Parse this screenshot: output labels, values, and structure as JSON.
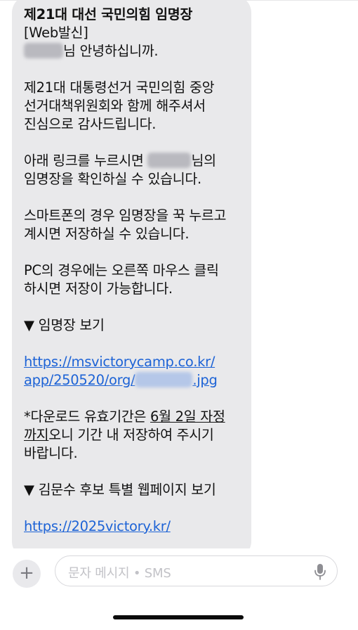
{
  "message": {
    "title": "제21대 대선 국민의힘 임명장",
    "sender_tag": "[Web발신]",
    "greeting_suffix": "님 안녕하십니까.",
    "para1": [
      "제21대 대통령선거 국민의힘 중앙",
      "선거대책위원회와 함께 해주셔서",
      "진심으로 감사드립니다."
    ],
    "para2_line1_prefix": "아래 링크를 누르시면 ",
    "para2_line1_suffix": "님의",
    "para2_line2": "임명장을 확인하실 수 있습니다.",
    "para3": [
      "스마트폰의 경우 임명장을 꾹 누르고",
      "계시면 저장하실 수 있습니다."
    ],
    "para4": [
      "PC의 경우에는 오른쪽 마우스 클릭",
      "하시면 저장이 가능합니다."
    ],
    "section1": "▼ 임명장 보기",
    "link1_line1": "https://msvictorycamp.co.kr/",
    "link1_line2_prefix": "app/250520/org/",
    "link1_line2_suffix": ".jpg",
    "notice_line1_prefix": "*다운로드 유효기간은 ",
    "notice_line1_underlined": "6월 2일 자정",
    "notice_line2_underlined": "까지",
    "notice_line2_rest": "오니 기간 내 저장하여 주시기",
    "notice_line3": "바랍니다.",
    "section2": "▼ 김문수 후보 특별 웹페이지 보기",
    "link2": "https://2025victory.kr/"
  },
  "composer": {
    "placeholder": "문자 메시지 • SMS",
    "plus_label": "+",
    "mic_icon": "mic-icon"
  },
  "colors": {
    "bubble": "#e9e9eb",
    "link": "#1d63d6",
    "text": "#111111"
  }
}
